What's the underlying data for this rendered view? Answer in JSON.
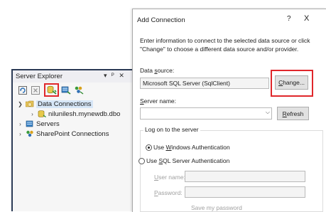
{
  "server_explorer": {
    "title": "Server Explorer",
    "title_buttons": [
      "▾",
      "ᴾ",
      "✕"
    ],
    "toolbar": [
      {
        "icon": "refresh-icon"
      },
      {
        "icon": "stop-refresh-icon"
      },
      {
        "icon": "connect-to-database-icon",
        "highlighted": true
      },
      {
        "icon": "connect-to-server-icon"
      },
      {
        "icon": "connect-to-sharepoint-icon"
      }
    ],
    "tree": [
      {
        "label": "Data Connections",
        "expanded": true,
        "level": 0,
        "selected": true
      },
      {
        "label": "nilunilesh.mynewdb.dbo",
        "expanded": false,
        "level": 1
      },
      {
        "label": "Servers",
        "expanded": false,
        "level": 0
      },
      {
        "label": "SharePoint Connections",
        "expanded": false,
        "level": 0
      }
    ]
  },
  "dialog": {
    "title": "Add Connection",
    "help": "?",
    "close": "X",
    "description": "Enter information to connect to the selected data source or click \"Change\" to choose a different data source and/or provider.",
    "data_source": {
      "label_prefix": "Data ",
      "label_accel": "s",
      "label_suffix": "ource:",
      "value": "Microsoft SQL Server (SqlClient)",
      "change_accel": "C",
      "change_rest": "hange..."
    },
    "server_name": {
      "label_accel": "S",
      "label_rest": "erver name:",
      "value": "",
      "refresh_accel": "R",
      "refresh_rest": "efresh"
    },
    "logon": {
      "group_label": "Log on to the server",
      "windows_auth_prefix": "Use ",
      "windows_auth_accel": "W",
      "windows_auth_rest": "indows Authentication",
      "sql_auth_prefix": "Use ",
      "sql_auth_accel": "S",
      "sql_auth_mid": "QL",
      "sql_auth_rest": " Server Authentication",
      "selected": "windows",
      "user_name_accel": "U",
      "user_name_rest": "ser name:",
      "password_accel": "P",
      "password_rest": "assword:",
      "save_password_partial": "Save my password"
    }
  },
  "colors": {
    "highlight_red": "#e0272b",
    "panel_border": "#2b3a55"
  }
}
